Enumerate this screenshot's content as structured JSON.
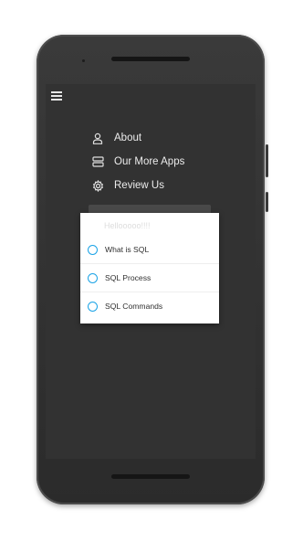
{
  "menu": {
    "items": [
      {
        "label": "About",
        "icon": "person-icon"
      },
      {
        "label": "Our More Apps",
        "icon": "apps-icon"
      },
      {
        "label": "Review Us",
        "icon": "gear-icon"
      }
    ]
  },
  "dialog": {
    "title": "Hellooooo!!!!",
    "options": [
      "What is SQL",
      "SQL Process",
      "SQL Commands"
    ]
  },
  "colors": {
    "screen_bg": "#323232",
    "accent": "#1aa3e6",
    "dialog_bg": "#ffffff"
  }
}
